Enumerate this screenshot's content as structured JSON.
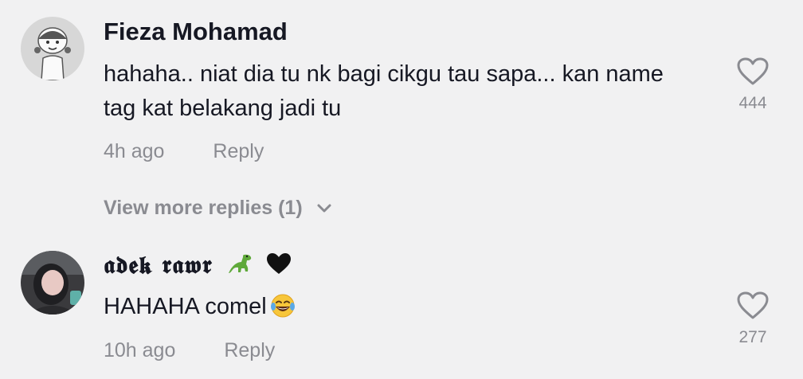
{
  "comments": [
    {
      "username": "Fieza Mohamad",
      "text_lines": [
        "hahaha.. niat dia tu nk bagi cikgu tau sapa... kan name",
        "tag kat belakang jadi tu"
      ],
      "time": "4h ago",
      "reply_label": "Reply",
      "like_count": "444",
      "avatar_icon": "cartoon-girl-avatar"
    },
    {
      "username": "𝖆𝖉𝖊𝖐 𝖗𝖆𝖜𝖗",
      "username_emoji": [
        "dinosaur-emoji",
        "black-heart-emoji"
      ],
      "text": "HAHAHA comel",
      "text_emoji": "laughing-tears-emoji",
      "time": "10h ago",
      "reply_label": "Reply",
      "like_count": "277",
      "avatar_icon": "user-photo-avatar"
    }
  ],
  "view_more_replies": "View more replies (1)",
  "colors": {
    "background": "#f1f1f2",
    "primary_text": "#161823",
    "secondary_text": "#8a8b91"
  }
}
